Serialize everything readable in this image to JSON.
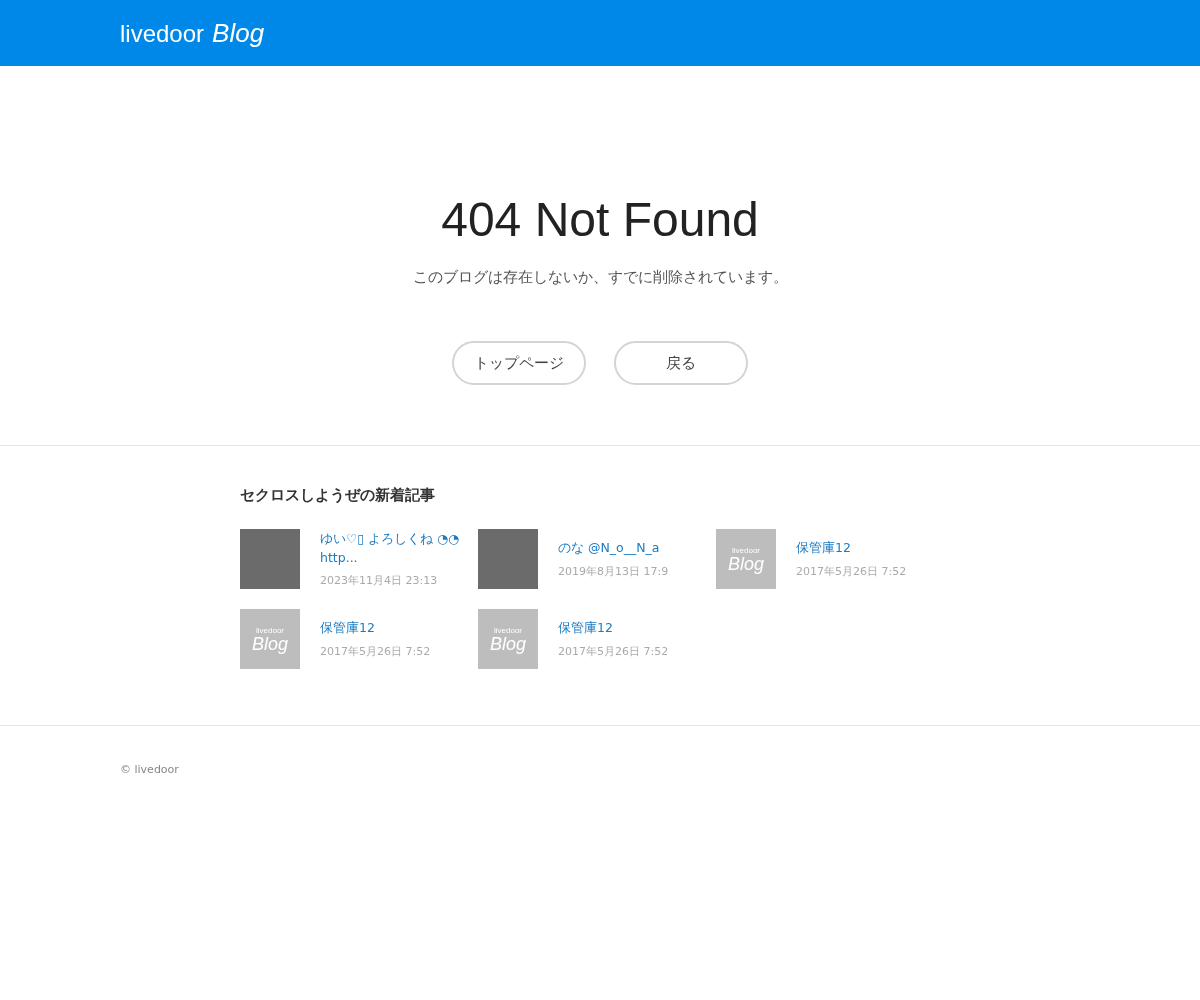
{
  "header": {
    "logo_word": "livedoor",
    "logo_product": "Blog"
  },
  "error": {
    "title": "404 Not Found",
    "message": "このブログは存在しないか、すでに削除されています。"
  },
  "buttons": [
    "トップページ",
    "戻る"
  ],
  "recent": {
    "heading": "セクロスしようぜの新着記事",
    "articles": [
      {
        "title": "ゆい♡▯ よろしくね ◔◔ http...",
        "date": "2023年11月4日 23:13",
        "thumb": {
          "kind": "photo"
        }
      },
      {
        "title": "のな @N_o__N_a",
        "date": "2019年8月13日 17:9",
        "thumb": {
          "kind": "photo"
        }
      },
      {
        "title": "保管庫12",
        "date": "2017年5月26日 7:52",
        "thumb": {
          "kind": "logo",
          "top": "livedoor",
          "bottom": "Blog"
        }
      },
      {
        "title": "保管庫12",
        "date": "2017年5月26日 7:52",
        "thumb": {
          "kind": "logo",
          "top": "livedoor",
          "bottom": "Blog"
        }
      },
      {
        "title": "保管庫12",
        "date": "2017年5月26日 7:52",
        "thumb": {
          "kind": "logo",
          "top": "livedoor",
          "bottom": "Blog"
        }
      }
    ]
  },
  "footer": {
    "copyright": "© livedoor"
  }
}
